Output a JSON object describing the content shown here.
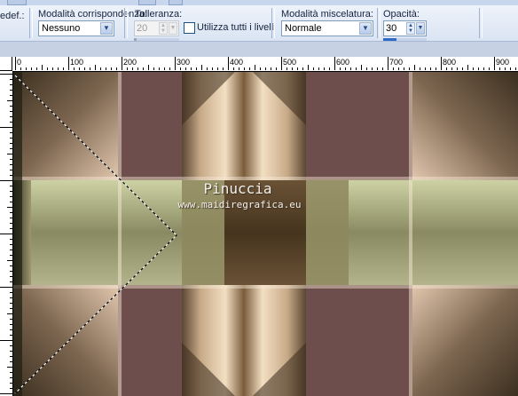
{
  "toolbar": {
    "preset_label": "edef.:",
    "match_mode": {
      "label": "Modalità corrispondenza:",
      "value": "Nessuno"
    },
    "tolerance": {
      "label": "Tolleranza:",
      "value": "20"
    },
    "all_layers": {
      "label": "Utilizza tutti i livelli",
      "checked": false
    },
    "blend_mode": {
      "label": "Modalità miscelatura:",
      "value": "Normale"
    },
    "opacity": {
      "label": "Opacità:",
      "value": "30",
      "percent": 30
    }
  },
  "ruler": {
    "h_labels": [
      "0",
      "100",
      "200",
      "300",
      "400",
      "500",
      "600",
      "700",
      "800",
      "900"
    ]
  },
  "watermark": {
    "name": "Pinuccia",
    "url": "www.maidiregrafica.eu"
  },
  "icons": {
    "dropdown": "chevron-down-icon",
    "spinner": "spinner-arrows-icon",
    "checkbox": "checkbox-icon"
  },
  "colors": {
    "toolbar_bg": "#dae4f3",
    "accent": "#2f6ac6",
    "field_border": "#7f9db9"
  }
}
